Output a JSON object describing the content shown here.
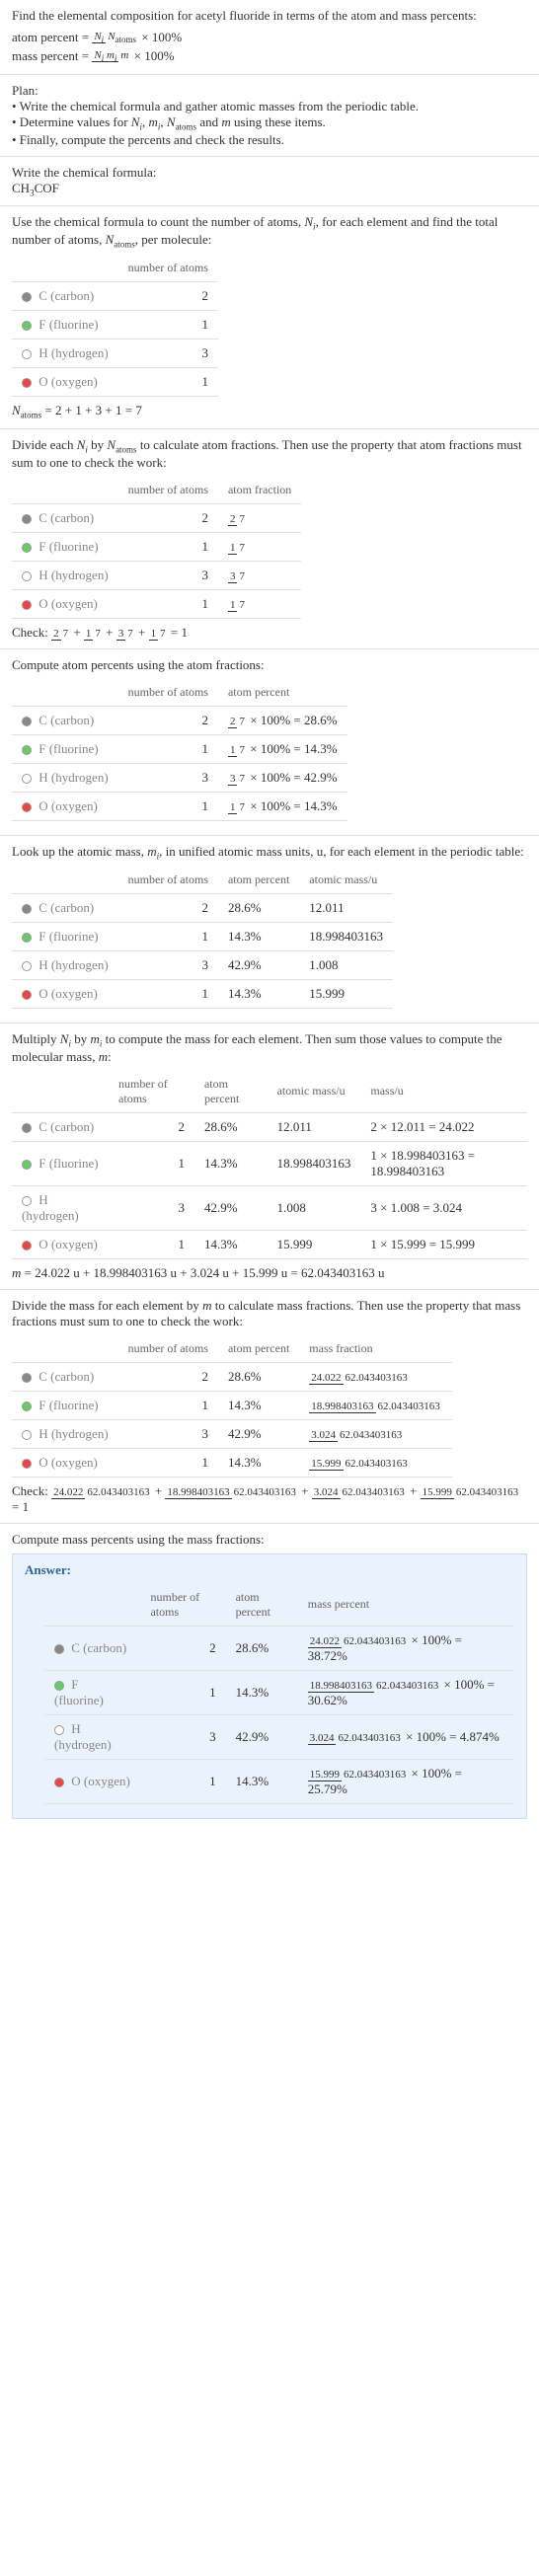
{
  "intro": {
    "prompt": "Find the elemental composition for acetyl fluoride in terms of the atom and mass percents:",
    "atom_percent_formula": "atom percent = (N_i / N_atoms) × 100%",
    "mass_percent_formula": "mass percent = (N_i m_i / m) × 100%"
  },
  "plan": {
    "title": "Plan:",
    "b1": "• Write the chemical formula and gather atomic masses from the periodic table.",
    "b2": "• Determine values for N_i, m_i, N_atoms and m using these items.",
    "b3": "• Finally, compute the percents and check the results."
  },
  "formula_block": {
    "title": "Write the chemical formula:",
    "formula": "CH₃COF"
  },
  "count_block": {
    "intro": "Use the chemical formula to count the number of atoms, N_i, for each element and find the total number of atoms, N_atoms, per molecule:",
    "col1": "number of atoms",
    "rows": [
      {
        "el": "C (carbon)",
        "n": "2",
        "dot": "dot-c"
      },
      {
        "el": "F (fluorine)",
        "n": "1",
        "dot": "dot-f"
      },
      {
        "el": "H (hydrogen)",
        "n": "3",
        "dot": "dot-h"
      },
      {
        "el": "O (oxygen)",
        "n": "1",
        "dot": "dot-o"
      }
    ],
    "sum": "N_atoms = 2 + 1 + 3 + 1 = 7"
  },
  "atom_fraction_block": {
    "intro": "Divide each N_i by N_atoms to calculate atom fractions. Then use the property that atom fractions must sum to one to check the work:",
    "col1": "number of atoms",
    "col2": "atom fraction",
    "rows": [
      {
        "el": "C (carbon)",
        "n": "2",
        "fn": "2",
        "fd": "7",
        "dot": "dot-c"
      },
      {
        "el": "F (fluorine)",
        "n": "1",
        "fn": "1",
        "fd": "7",
        "dot": "dot-f"
      },
      {
        "el": "H (hydrogen)",
        "n": "3",
        "fn": "3",
        "fd": "7",
        "dot": "dot-h"
      },
      {
        "el": "O (oxygen)",
        "n": "1",
        "fn": "1",
        "fd": "7",
        "dot": "dot-o"
      }
    ],
    "check_label": "Check: ",
    "check_expr": "2/7 + 1/7 + 3/7 + 1/7 = 1"
  },
  "atom_percent_block": {
    "intro": "Compute atom percents using the atom fractions:",
    "col1": "number of atoms",
    "col2": "atom percent",
    "rows": [
      {
        "el": "C (carbon)",
        "n": "2",
        "fn": "2",
        "fd": "7",
        "res": " × 100% = 28.6%",
        "dot": "dot-c"
      },
      {
        "el": "F (fluorine)",
        "n": "1",
        "fn": "1",
        "fd": "7",
        "res": " × 100% = 14.3%",
        "dot": "dot-f"
      },
      {
        "el": "H (hydrogen)",
        "n": "3",
        "fn": "3",
        "fd": "7",
        "res": " × 100% = 42.9%",
        "dot": "dot-h"
      },
      {
        "el": "O (oxygen)",
        "n": "1",
        "fn": "1",
        "fd": "7",
        "res": " × 100% = 14.3%",
        "dot": "dot-o"
      }
    ]
  },
  "atomic_mass_block": {
    "intro": "Look up the atomic mass, m_i, in unified atomic mass units, u, for each element in the periodic table:",
    "col1": "number of atoms",
    "col2": "atom percent",
    "col3": "atomic mass/u",
    "rows": [
      {
        "el": "C (carbon)",
        "n": "2",
        "p": "28.6%",
        "m": "12.011",
        "dot": "dot-c"
      },
      {
        "el": "F (fluorine)",
        "n": "1",
        "p": "14.3%",
        "m": "18.998403163",
        "dot": "dot-f"
      },
      {
        "el": "H (hydrogen)",
        "n": "3",
        "p": "42.9%",
        "m": "1.008",
        "dot": "dot-h"
      },
      {
        "el": "O (oxygen)",
        "n": "1",
        "p": "14.3%",
        "m": "15.999",
        "dot": "dot-o"
      }
    ]
  },
  "mass_block": {
    "intro": "Multiply N_i by m_i to compute the mass for each element. Then sum those values to compute the molecular mass, m:",
    "col1": "number of atoms",
    "col2": "atom percent",
    "col3": "atomic mass/u",
    "col4": "mass/u",
    "rows": [
      {
        "el": "C (carbon)",
        "n": "2",
        "p": "28.6%",
        "m": "12.011",
        "mu": "2 × 12.011 = 24.022",
        "dot": "dot-c"
      },
      {
        "el": "F (fluorine)",
        "n": "1",
        "p": "14.3%",
        "m": "18.998403163",
        "mu": "1 × 18.998403163 = 18.998403163",
        "dot": "dot-f"
      },
      {
        "el": "H (hydrogen)",
        "n": "3",
        "p": "42.9%",
        "m": "1.008",
        "mu": "3 × 1.008 = 3.024",
        "dot": "dot-h"
      },
      {
        "el": "O (oxygen)",
        "n": "1",
        "p": "14.3%",
        "m": "15.999",
        "mu": "1 × 15.999 = 15.999",
        "dot": "dot-o"
      }
    ],
    "sum": "m = 24.022 u + 18.998403163 u + 3.024 u + 15.999 u = 62.043403163 u"
  },
  "mass_fraction_block": {
    "intro": "Divide the mass for each element by m to calculate mass fractions. Then use the property that mass fractions must sum to one to check the work:",
    "col1": "number of atoms",
    "col2": "atom percent",
    "col3": "mass fraction",
    "denom": "62.043403163",
    "rows": [
      {
        "el": "C (carbon)",
        "n": "2",
        "p": "28.6%",
        "mn": "24.022",
        "dot": "dot-c"
      },
      {
        "el": "F (fluorine)",
        "n": "1",
        "p": "14.3%",
        "mn": "18.998403163",
        "dot": "dot-f"
      },
      {
        "el": "H (hydrogen)",
        "n": "3",
        "p": "42.9%",
        "mn": "3.024",
        "dot": "dot-h"
      },
      {
        "el": "O (oxygen)",
        "n": "1",
        "p": "14.3%",
        "mn": "15.999",
        "dot": "dot-o"
      }
    ],
    "check_label": "Check: ",
    "check_expr_end": " = 1"
  },
  "answer_block": {
    "intro": "Compute mass percents using the mass fractions:",
    "label": "Answer:",
    "col1": "number of atoms",
    "col2": "atom percent",
    "col3": "mass percent",
    "denom": "62.043403163",
    "rows": [
      {
        "el": "C (carbon)",
        "n": "2",
        "p": "28.6%",
        "mn": "24.022",
        "res": " × 100% = 38.72%",
        "dot": "dot-c"
      },
      {
        "el": "F (fluorine)",
        "n": "1",
        "p": "14.3%",
        "mn": "18.998403163",
        "res": " × 100% = 30.62%",
        "dot": "dot-f"
      },
      {
        "el": "H (hydrogen)",
        "n": "3",
        "p": "42.9%",
        "mn": "3.024",
        "res": " × 100% = 4.874%",
        "dot": "dot-h"
      },
      {
        "el": "O (oxygen)",
        "n": "1",
        "p": "14.3%",
        "mn": "15.999",
        "res": " × 100% = 25.79%",
        "dot": "dot-o"
      }
    ]
  }
}
